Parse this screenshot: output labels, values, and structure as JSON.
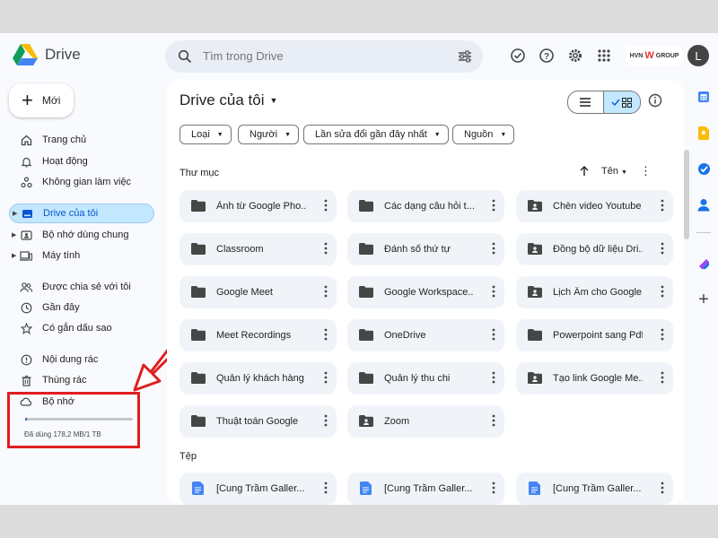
{
  "app": {
    "name": "Drive"
  },
  "search": {
    "placeholder": "Tìm trong Drive"
  },
  "header": {
    "brand": "HVN",
    "brand_mark": "W",
    "brand_suffix": "GROUP",
    "avatar_initial": "L"
  },
  "sidebar": {
    "new_label": "Mới",
    "items": [
      {
        "label": "Trang chủ",
        "icon": "home-icon"
      },
      {
        "label": "Hoạt động",
        "icon": "bell-icon"
      },
      {
        "label": "Không gian làm việc",
        "icon": "workspaces-icon"
      },
      {
        "label": "Drive của tôi",
        "icon": "my-drive-icon",
        "active": true
      },
      {
        "label": "Bộ nhớ dùng chung",
        "icon": "shared-drives-icon"
      },
      {
        "label": "Máy tính",
        "icon": "computer-icon"
      },
      {
        "label": "Được chia sẻ với tôi",
        "icon": "people-icon"
      },
      {
        "label": "Gần đây",
        "icon": "clock-icon"
      },
      {
        "label": "Có gắn dấu sao",
        "icon": "star-icon"
      },
      {
        "label": "Nội dung rác",
        "icon": "spam-icon"
      },
      {
        "label": "Thùng rác",
        "icon": "trash-icon"
      },
      {
        "label": "Bộ nhớ",
        "icon": "cloud-icon"
      }
    ],
    "storage_text": "Đã dùng 178,2 MB/1 TB",
    "storage_used_fraction": 0.0002
  },
  "main": {
    "title": "Drive của tôi",
    "filters": [
      "Loại",
      "Người",
      "Lần sửa đổi gần đây nhất",
      "Nguồn"
    ],
    "folders_label": "Thư mục",
    "sort_label": "Tên",
    "folders": [
      {
        "name": "Ảnh từ Google Pho...",
        "shared": false
      },
      {
        "name": "Các dạng câu hỏi t...",
        "shared": false
      },
      {
        "name": "Chèn video Youtube",
        "shared": true
      },
      {
        "name": "Classroom",
        "shared": false
      },
      {
        "name": "Đánh số thứ tự",
        "shared": false
      },
      {
        "name": "Đồng bộ dữ liệu Dri...",
        "shared": true
      },
      {
        "name": "Google Meet",
        "shared": false
      },
      {
        "name": "Google Workspace...",
        "shared": false
      },
      {
        "name": "Lịch Âm cho Google...",
        "shared": true
      },
      {
        "name": "Meet Recordings",
        "shared": false
      },
      {
        "name": "OneDrive",
        "shared": false
      },
      {
        "name": "Powerpoint sang Pdf",
        "shared": false
      },
      {
        "name": "Quản lý khách hàng",
        "shared": false
      },
      {
        "name": "Quản lý thu chi",
        "shared": false
      },
      {
        "name": "Tạo link Google Me...",
        "shared": true
      },
      {
        "name": "Thuật toán Google",
        "shared": false
      },
      {
        "name": "Zoom",
        "shared": true
      }
    ],
    "files_label": "Tệp",
    "files": [
      {
        "name": "[Cung Trầm Galler..."
      },
      {
        "name": "[Cung Trầm Galler..."
      },
      {
        "name": "[Cung Trầm Galler..."
      }
    ]
  },
  "colors": {
    "accent": "#0b57d0",
    "active_bg": "#c2e7ff",
    "annotation": "#e01e1e",
    "doc_blue": "#4285f4"
  }
}
